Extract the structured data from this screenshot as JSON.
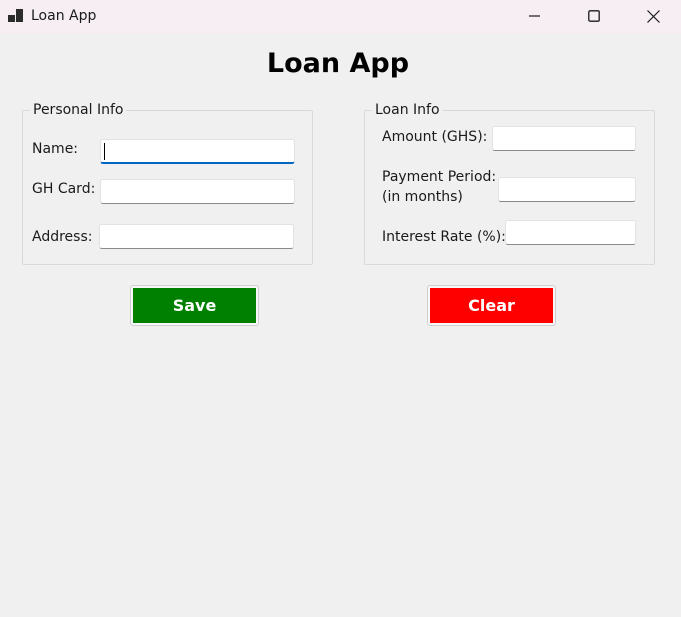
{
  "window": {
    "title": "Loan App",
    "minimize_icon": "minimize-icon",
    "maximize_icon": "maximize-icon",
    "close_icon": "close-icon"
  },
  "heading": "Loan App",
  "personal_info": {
    "legend": "Personal Info",
    "name_label": "Name:",
    "name_value": "",
    "gh_card_label": "GH Card:",
    "gh_card_value": "",
    "address_label": "Address:",
    "address_value": ""
  },
  "loan_info": {
    "legend": "Loan Info",
    "amount_label": "Amount (GHS):",
    "amount_value": "",
    "payment_period_label_line1": "Payment Period:",
    "payment_period_label_line2": "(in months)",
    "payment_period_value": "",
    "interest_rate_label": "Interest Rate (%):",
    "interest_rate_value": ""
  },
  "actions": {
    "save_label": "Save",
    "save_color": "#008000",
    "clear_label": "Clear",
    "clear_color": "#ff0000"
  },
  "colors": {
    "background": "#f0f0f0",
    "titlebar": "#f6eef3",
    "focus_accent": "#0067c0"
  }
}
